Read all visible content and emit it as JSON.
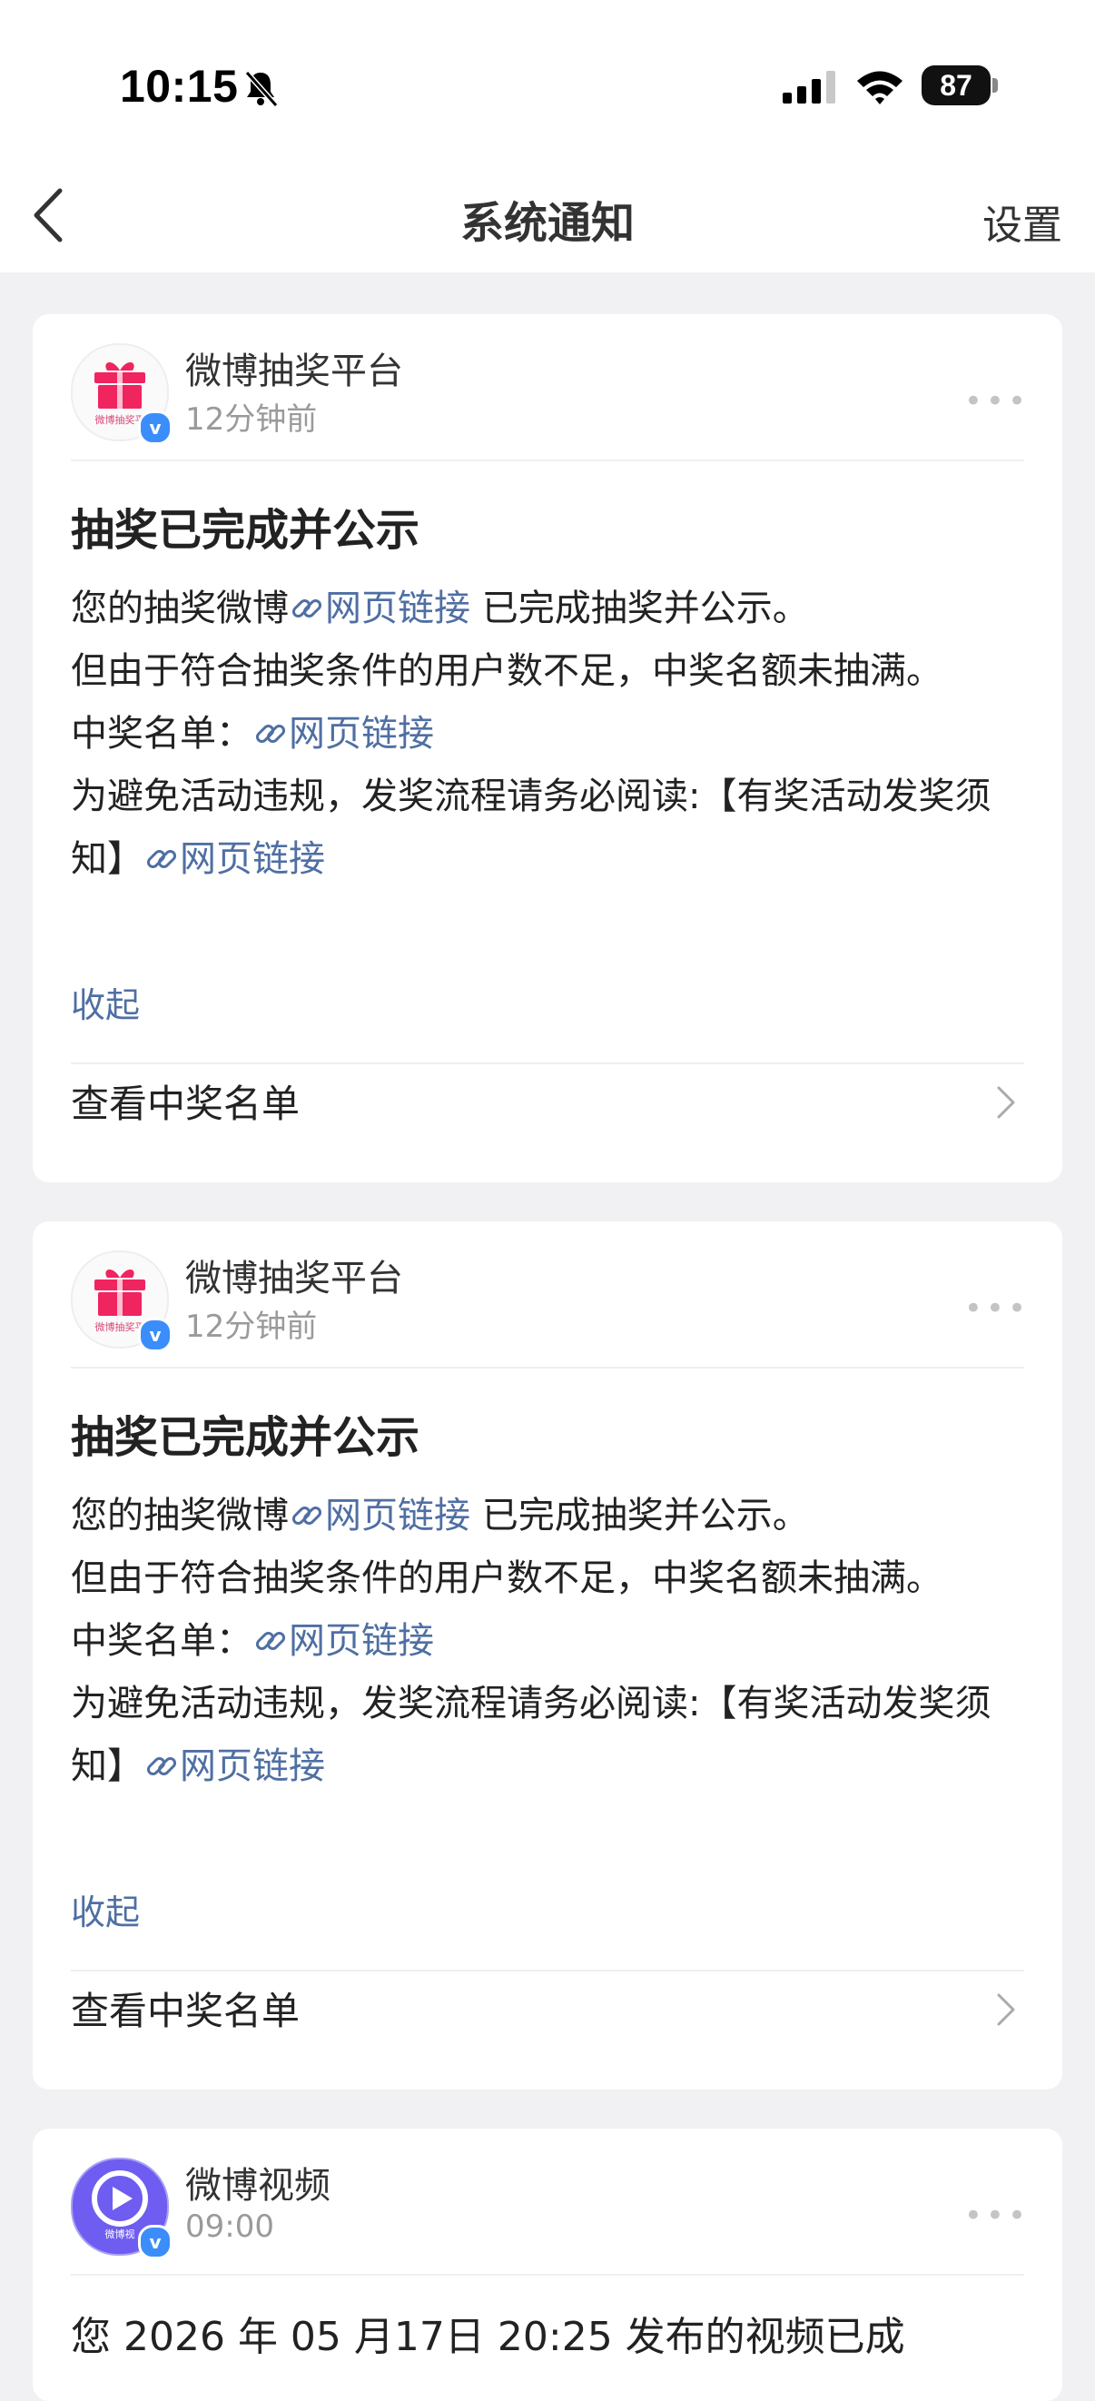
{
  "status_bar": {
    "time": "10:15",
    "battery": "87"
  },
  "nav": {
    "title": "系统通知",
    "settings": "设置"
  },
  "notifications": [
    {
      "sender": "微博抽奖平台",
      "avatar_text": "微博抽奖平",
      "time": "12分钟前",
      "title": "抽奖已完成并公示",
      "line1_prefix": "您的抽奖微博",
      "link_text": "网页链接",
      "line1_suffix": " 已完成抽奖并公示。",
      "line2": "但由于符合抽奖条件的用户数不足，中奖名额未抽满。",
      "line3_prefix": "中奖名单：",
      "line4": "为避免活动违规，发奖流程请务必阅读:【有奖活动发奖须知】",
      "collapse": "收起",
      "view_winners": "查看中奖名单"
    },
    {
      "sender": "微博抽奖平台",
      "avatar_text": "微博抽奖平",
      "time": "12分钟前",
      "title": "抽奖已完成并公示",
      "line1_prefix": "您的抽奖微博",
      "link_text": "网页链接",
      "line1_suffix": " 已完成抽奖并公示。",
      "line2": "但由于符合抽奖条件的用户数不足，中奖名额未抽满。",
      "line3_prefix": "中奖名单：",
      "line4": "为避免活动违规，发奖流程请务必阅读:【有奖活动发奖须知】",
      "collapse": "收起",
      "view_winners": "查看中奖名单"
    },
    {
      "sender": "微博视频",
      "avatar_text": "微博视",
      "time": "09:00",
      "body": "您 2026 年 05 月17日 20:25 发布的视频已成"
    }
  ],
  "colors": {
    "link": "#4f6fa3",
    "verified": "#3b8dfa",
    "gift": "#f0245e",
    "video_avatar": "#6f5cf0"
  }
}
